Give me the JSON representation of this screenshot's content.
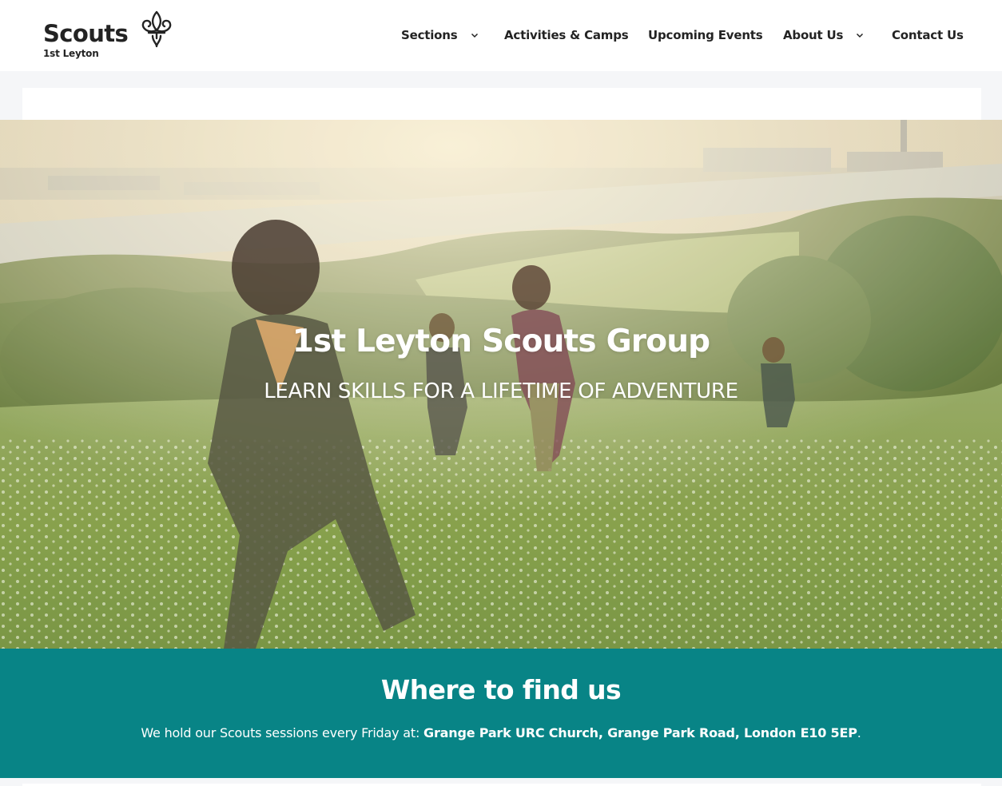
{
  "brand": {
    "wordmark": "Scouts",
    "group_name": "1st Leyton",
    "logo_icon": "fleur-de-lis-icon"
  },
  "nav": {
    "items": [
      {
        "label": "Sections",
        "has_dropdown": true
      },
      {
        "label": "Activities & Camps",
        "has_dropdown": false
      },
      {
        "label": "Upcoming Events",
        "has_dropdown": false
      },
      {
        "label": "About Us",
        "has_dropdown": true
      },
      {
        "label": "Contact Us",
        "has_dropdown": false
      }
    ]
  },
  "hero": {
    "title": "1st Leyton Scouts Group",
    "subtitle": "LEARN SKILLS FOR A LIFETIME OF ADVENTURE"
  },
  "find_us": {
    "title": "Where to find us",
    "text_prefix": "We hold our Scouts sessions every Friday at: ",
    "address": "Grange Park URC Church, Grange Park Road, London E10 5EP",
    "text_suffix": "."
  },
  "colors": {
    "teal": "#088486",
    "text_dark": "#232323",
    "page_bg": "#f5f6f8"
  }
}
